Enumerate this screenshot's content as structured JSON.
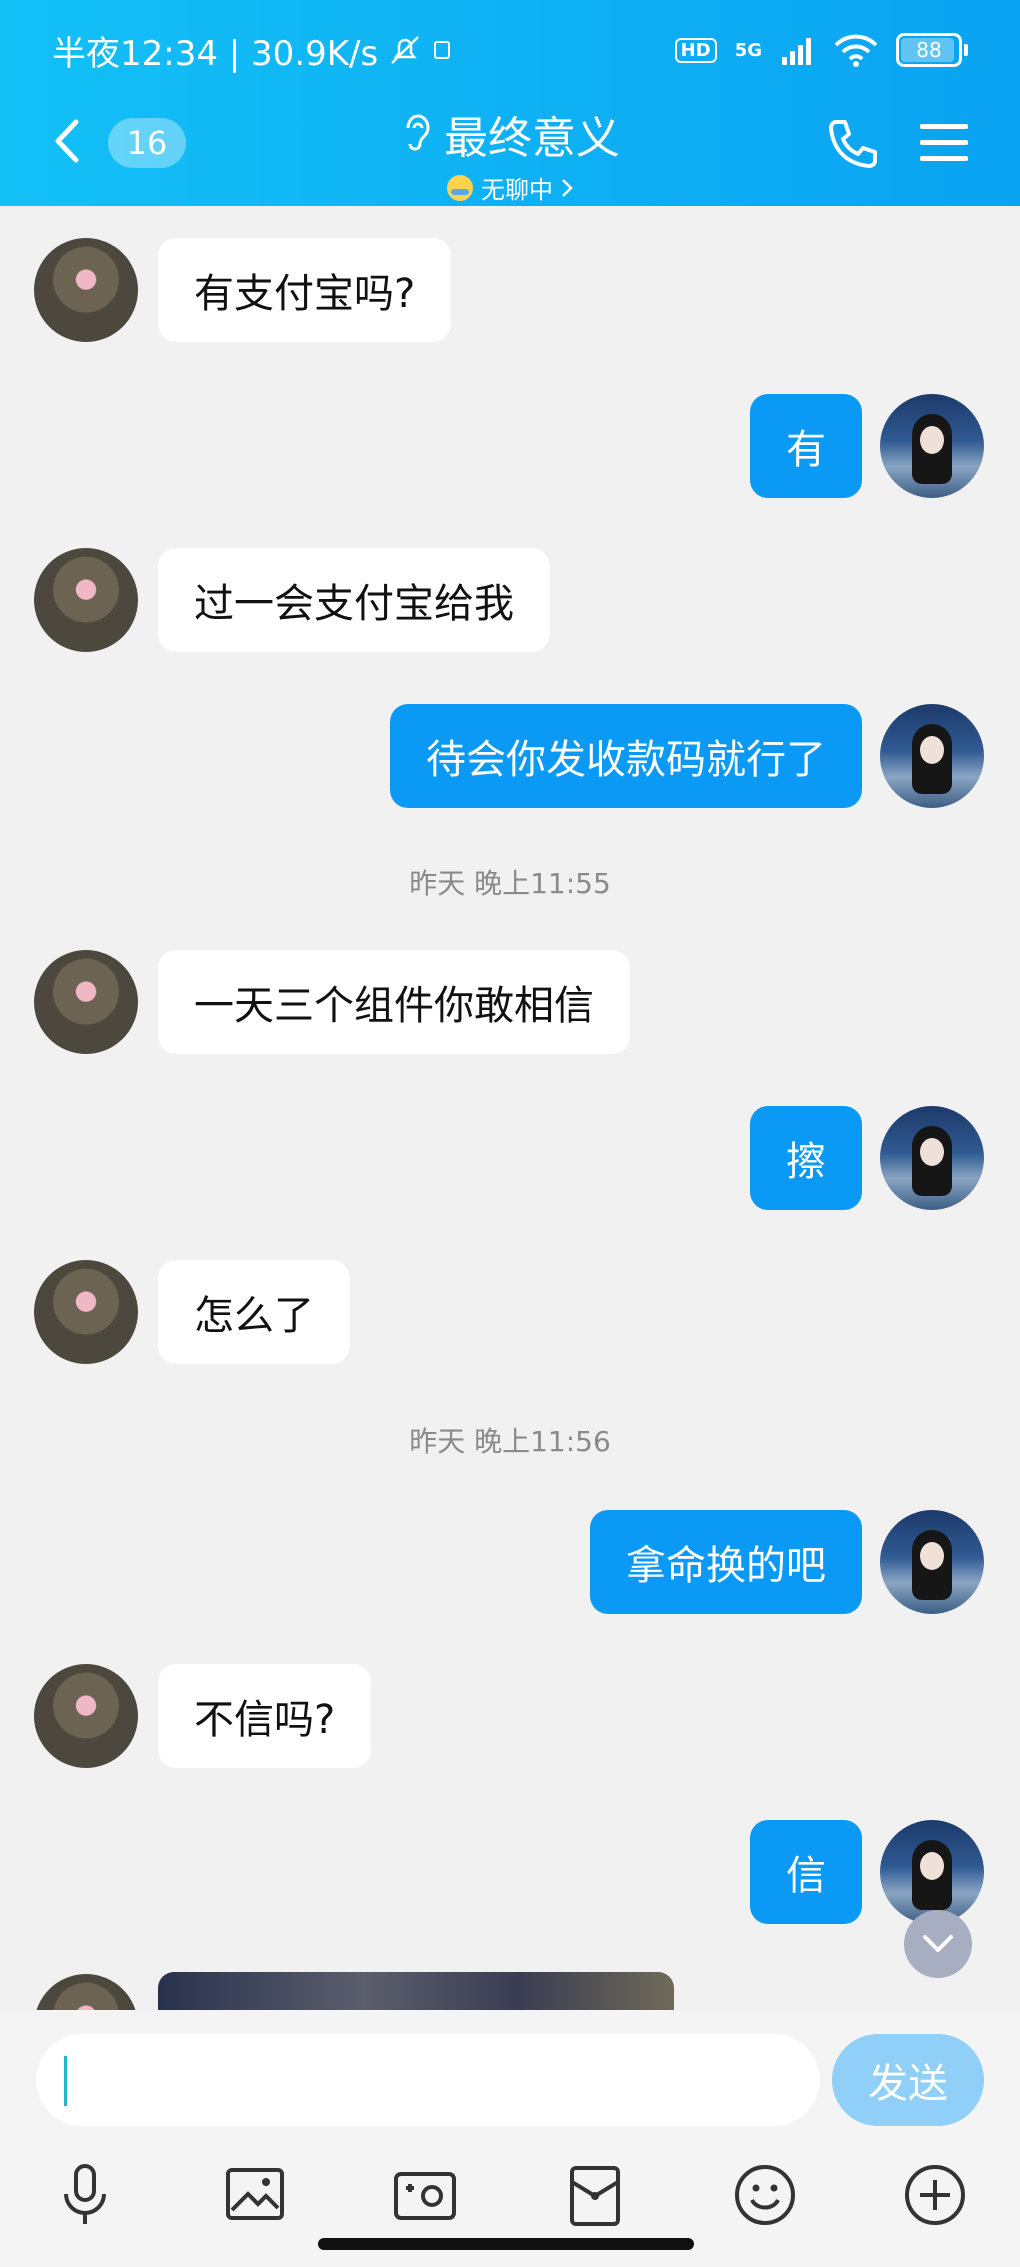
{
  "status_bar": {
    "time_speed": "半夜12:34 | 30.9K/s",
    "hd": "HD",
    "network": "5G",
    "battery": "88",
    "battery_level": 0.88
  },
  "header": {
    "back_count": "16",
    "title": "最终意义",
    "subtitle": "无聊中"
  },
  "messages": [
    {
      "side": "left",
      "text": "有支付宝吗?"
    },
    {
      "side": "right",
      "text": "有"
    },
    {
      "side": "left",
      "text": "过一会支付宝给我"
    },
    {
      "side": "right",
      "text": "待会你发收款码就行了"
    },
    {
      "type": "time",
      "text": "昨天 晚上11:55"
    },
    {
      "side": "left",
      "text": "一天三个组件你敢相信"
    },
    {
      "side": "right",
      "text": "擦"
    },
    {
      "side": "left",
      "text": "怎么了"
    },
    {
      "type": "time",
      "text": "昨天 晚上11:56"
    },
    {
      "side": "right",
      "text": "拿命换的吧"
    },
    {
      "side": "left",
      "text": "不信吗?"
    },
    {
      "side": "right",
      "text": "信"
    }
  ],
  "input": {
    "value": "",
    "send_label": "发送"
  },
  "toolbar": [
    "microphone-icon",
    "image-icon",
    "camera-icon",
    "red-packet-icon",
    "emoji-icon",
    "plus-icon"
  ],
  "colors": {
    "header": "#0aa3f2",
    "outgoing_bubble": "#0a99f5",
    "incoming_bubble": "#ffffff",
    "send_button": "#8fcff8"
  }
}
